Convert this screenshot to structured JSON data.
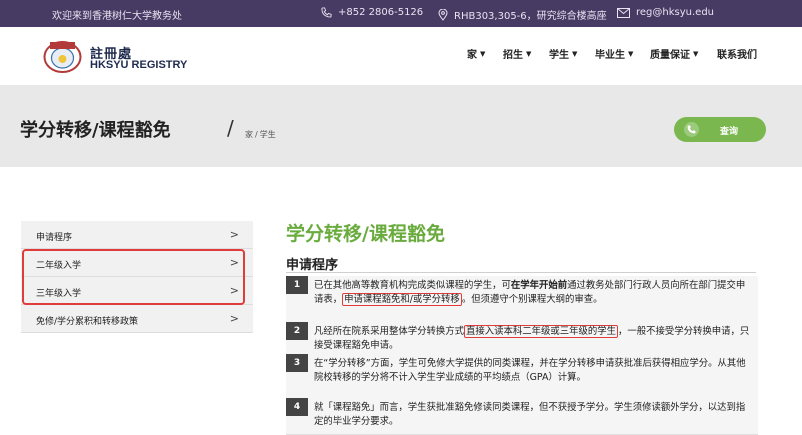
{
  "topbar": {
    "welcome": "欢迎来到香港树仁大学教务处",
    "phone": "+852 2806-5126",
    "address": "RHB303,305-6，研究综合楼高座",
    "email": "reg@hksyu.edu",
    "colors": {
      "background": "#473a63"
    }
  },
  "header": {
    "logo_seal_text": "樹仁大學",
    "logo_cn": "註冊處",
    "logo_en": "HKSYU REGISTRY",
    "nav": [
      {
        "label": "家",
        "has_caret": true
      },
      {
        "label": "招生",
        "has_caret": true
      },
      {
        "label": "学生",
        "has_caret": true
      },
      {
        "label": "毕业生",
        "has_caret": true
      },
      {
        "label": "质量保证",
        "has_caret": true
      },
      {
        "label": "联系我们",
        "has_caret": false
      }
    ]
  },
  "band": {
    "title": "学分转移/课程豁免",
    "slash": "/",
    "breadcrumb": [
      "家",
      "/",
      "学生"
    ],
    "query_button": "查询",
    "colors": {
      "button": "#7ab84f"
    }
  },
  "sidebar": {
    "items": [
      {
        "label": "申请程序",
        "chevron": ">"
      },
      {
        "label": "二年级入学",
        "chevron": ">"
      },
      {
        "label": "三年级入学",
        "chevron": ">"
      },
      {
        "label": "免修/学分累积和转移政策",
        "chevron": ">"
      }
    ]
  },
  "main": {
    "title": "学分转移/课程豁免",
    "section_title": "申请程序",
    "steps": [
      {
        "num": "1",
        "pre": "已在其他高等教育机构完成类似课程的学生，可",
        "bold": "在学年开始前",
        "mid": "通过教务处部门行政人员向所在部门提交申请表，",
        "highlight": "申请课程豁免和/或学分转移",
        "post": "。但须遵守个别课程大纲的审查。"
      },
      {
        "num": "2",
        "pre": "凡经所在院系采用整体学分转换方式",
        "highlight": "直接入读本科二年级或三年级的学生",
        "post": "，一般不接受学分转换申请，只接受课程豁免申请。"
      },
      {
        "num": "3",
        "text": "在“学分转移”方面，学生可免修大学提供的同类课程，并在学分转移申请获批准后获得相应学分。从其他院校转移的学分将不计入学生学业成绩的平均绩点（GPA）计算。"
      },
      {
        "num": "4",
        "text": "就「课程豁免」而言，学生获批准豁免修读同类课程，但不获授予学分。学生须修读额外学分，以达到指定的毕业学分要求。"
      }
    ],
    "colors": {
      "title": "#6aab3e",
      "highlight_border": "#e03c3c"
    }
  }
}
